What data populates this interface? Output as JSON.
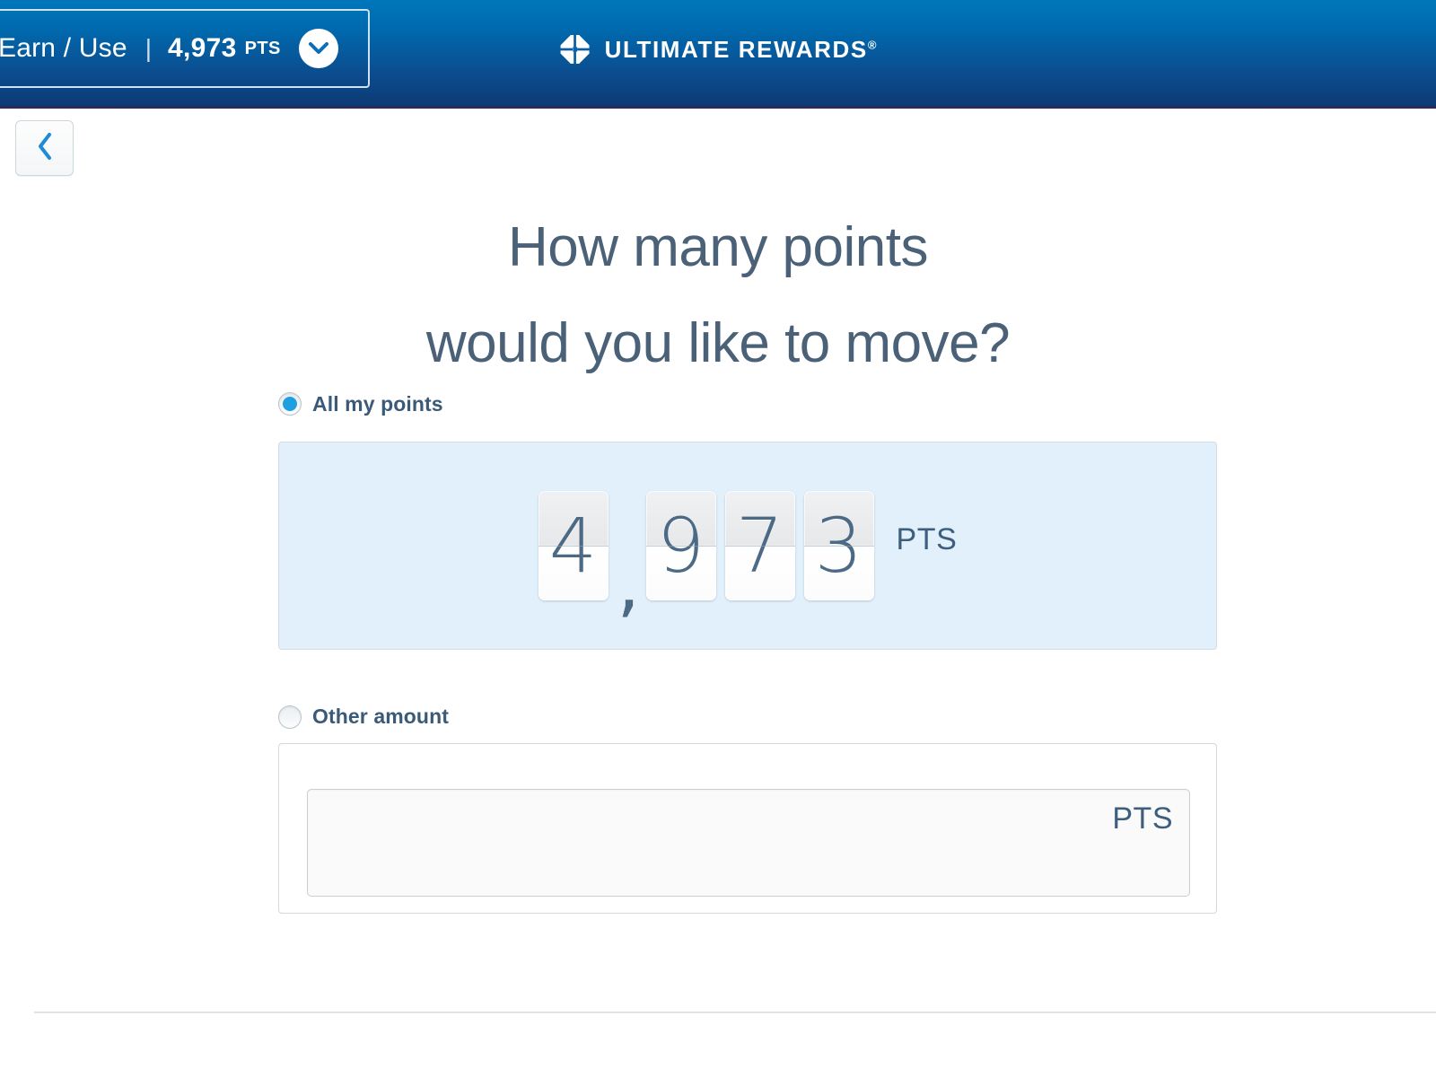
{
  "header": {
    "earn_use_label": "Earn / Use",
    "separator": "|",
    "points_value": "4,973",
    "points_unit": "PTS",
    "dropdown_icon": "chevron-down-icon",
    "brand_name": "ULTIMATE REWARDS",
    "brand_registered_mark": "®",
    "brand_logo_icon": "chase-octagon-logo-icon",
    "gradient_top_color": "#0077bb",
    "gradient_bottom_color": "#0d3a74",
    "underline_color": "#2a2a5e"
  },
  "nav": {
    "back_button_icon": "chevron-left-icon",
    "back_icon_color": "#1f8ad6"
  },
  "main": {
    "heading_line_1": "How many points",
    "heading_line_2": "would you like to move?",
    "heading_color": "#4a6178",
    "options": [
      {
        "id": "all-my-points",
        "label": "All my points",
        "selected": true
      },
      {
        "id": "other-amount",
        "label": "Other amount",
        "selected": false
      }
    ],
    "points_display": {
      "digits": [
        "4",
        ",",
        "9",
        "7",
        "3"
      ],
      "value": "4,973",
      "unit": "PTS",
      "panel_background": "#e1f0fb",
      "digit_color": "#4c6a85"
    },
    "other_amount_input": {
      "value": "",
      "placeholder": "",
      "unit": "PTS"
    },
    "accent_color": "#1f9fe0"
  }
}
